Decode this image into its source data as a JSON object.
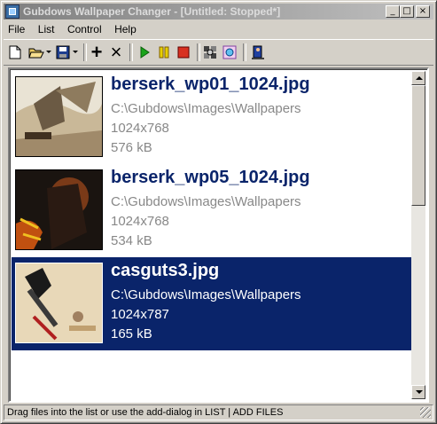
{
  "window": {
    "title": "Gubdows Wallpaper Changer  -  [Untitled: Stopped*]"
  },
  "title_buttons": {
    "minimize": "_",
    "maximize": "□",
    "close": "×"
  },
  "menu": {
    "items": [
      {
        "label": "File"
      },
      {
        "label": "List"
      },
      {
        "label": "Control"
      },
      {
        "label": "Help"
      }
    ]
  },
  "toolbar": {
    "buttons": [
      {
        "icon": "new-icon"
      },
      {
        "icon": "open-icon"
      },
      {
        "icon": "save-icon"
      },
      {
        "icon": "add-icon",
        "glyph": "+"
      },
      {
        "icon": "remove-icon",
        "glyph": "×"
      },
      {
        "icon": "play-icon"
      },
      {
        "icon": "pause-icon"
      },
      {
        "icon": "stop-icon"
      },
      {
        "icon": "shuffle-icon"
      },
      {
        "icon": "options-icon"
      },
      {
        "icon": "exit-icon"
      }
    ]
  },
  "list": {
    "items": [
      {
        "filename": "berserk_wp01_1024.jpg",
        "path": "C:\\Gubdows\\Images\\Wallpapers",
        "resolution": "1024x768",
        "size": "576 kB",
        "selected": false
      },
      {
        "filename": "berserk_wp05_1024.jpg",
        "path": "C:\\Gubdows\\Images\\Wallpapers",
        "resolution": "1024x768",
        "size": "534 kB",
        "selected": false
      },
      {
        "filename": "casguts3.jpg",
        "path": "C:\\Gubdows\\Images\\Wallpapers",
        "resolution": "1024x787",
        "size": "165 kB",
        "selected": true
      }
    ]
  },
  "status": {
    "text": "Drag files into the list or use the add-dialog in LIST | ADD FILES"
  },
  "colors": {
    "selection": "#0a246a",
    "title_text": "#0a246a",
    "detail_text": "#888888",
    "face": "#d4d0c8"
  }
}
